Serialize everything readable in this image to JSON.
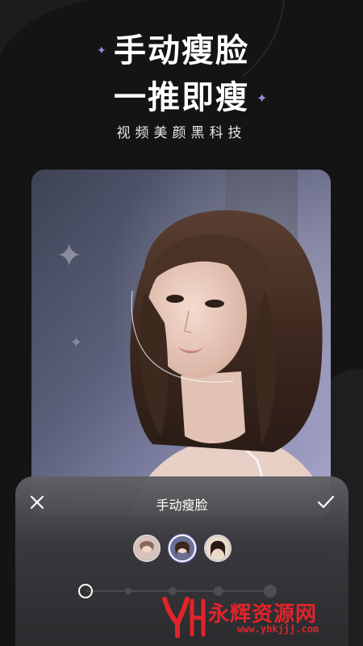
{
  "promo": {
    "headline_1": "手动瘦脸",
    "headline_2": "一推即瘦",
    "subheadline": "视频美颜黑科技"
  },
  "panel": {
    "title": "手动瘦脸",
    "close_icon": "close-icon",
    "confirm_icon": "check-icon",
    "thumbnails": [
      {
        "name": "face-thumb-1",
        "selected": false
      },
      {
        "name": "face-thumb-2",
        "selected": true
      },
      {
        "name": "face-thumb-3",
        "selected": false
      }
    ],
    "slider": {
      "stops": 5,
      "selected_index": 0
    }
  },
  "watermark": {
    "brand_text": "永辉资源网",
    "url": "www.yhkjjj.com"
  },
  "colors": {
    "background": "#141414",
    "accent_sparkle": "#8d8fd6",
    "watermark_red": "#e0242a"
  }
}
